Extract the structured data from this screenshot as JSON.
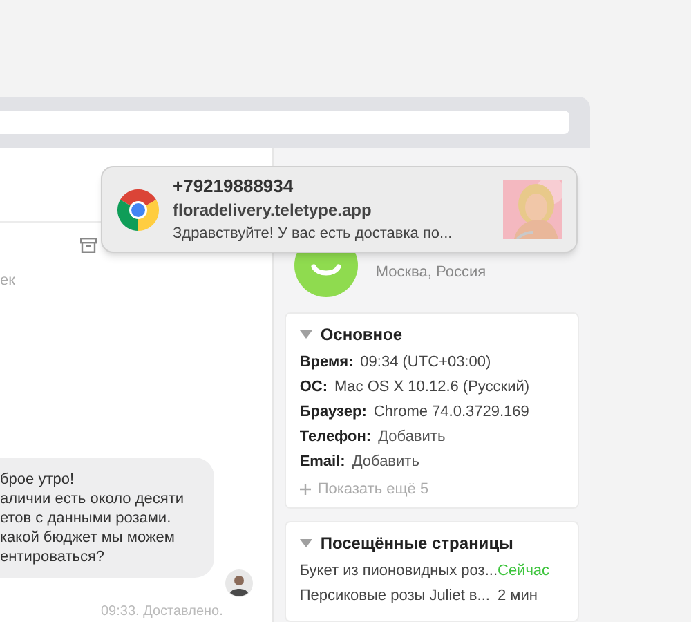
{
  "notification": {
    "title": "+79219888934",
    "source": "floradelivery.teletype.app",
    "message": "Здравствуйте! У вас есть доставка по..."
  },
  "chat": {
    "partial_label": "ек",
    "message": {
      "lines": [
        "брое утро!",
        "аличии есть около десяти",
        "етов с данными розами.",
        "какой бюджет мы можем",
        "ентироваться?"
      ],
      "status": "09:33. Доставлено."
    }
  },
  "contact": {
    "location": "Москва, Россия"
  },
  "info_card": {
    "title": "Основное",
    "expanded": true,
    "fields": [
      {
        "label": "Время:",
        "value": "09:34 (UTC+03:00)",
        "kind": "text"
      },
      {
        "label": "ОС:",
        "value": "Mac OS X 10.12.6 (Русский)",
        "kind": "text"
      },
      {
        "label": "Браузер:",
        "value": "Chrome 74.0.3729.169",
        "kind": "text"
      },
      {
        "label": "Телефон:",
        "value": "Добавить",
        "kind": "link"
      },
      {
        "label": "Email:",
        "value": "Добавить",
        "kind": "link"
      }
    ],
    "show_more": "Показать ещё 5"
  },
  "pages_card": {
    "title": "Посещённые страницы",
    "expanded": true,
    "rows": [
      {
        "page": "Букет из пионовидных роз...",
        "time": "Сейчас",
        "kind": "now"
      },
      {
        "page": "Персиковые розы Juliet в...",
        "time": "2 мин",
        "kind": "past"
      }
    ]
  }
}
